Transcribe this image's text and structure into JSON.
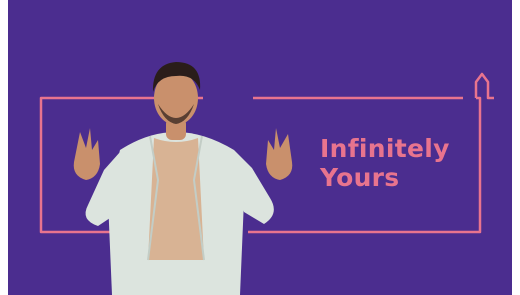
{
  "banner": {
    "tagline_line1": "Infinitely",
    "tagline_line2": "Yours",
    "colors": {
      "background": "#4b2d8f",
      "accent": "#e8748e",
      "jacket": "#dce4de",
      "tshirt": "#d8b394",
      "skin": "#c9906c",
      "hair": "#2a1d1a"
    }
  },
  "person": {
    "description_icon": "person-arms-raised-illustration"
  }
}
